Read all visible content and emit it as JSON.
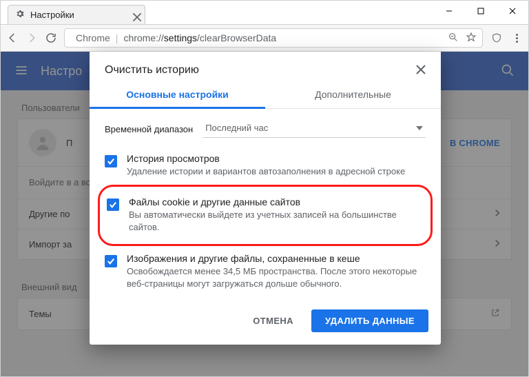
{
  "tab": {
    "title": "Настройки"
  },
  "omnibox": {
    "scheme_label": "Chrome",
    "url_grey1": "chrome://",
    "url_dark": "settings",
    "url_grey2": "/clearBrowserData"
  },
  "header": {
    "title": "Настро"
  },
  "sections": {
    "users_label": "Пользователи",
    "appearance_label": "Внешний вид"
  },
  "person": {
    "name": "П",
    "sign_in_btn": "В CHROME",
    "sign_in_desc": "Войдите в                                                                                                                               а всех устройств",
    "other_row": "Другие по",
    "import_row": "Импорт за"
  },
  "themes_row": "Темы",
  "dialog": {
    "title": "Очистить историю",
    "tabs": {
      "basic": "Основные настройки",
      "advanced": "Дополнительные"
    },
    "range_label": "Временной диапазон",
    "range_value": "Последний час",
    "items": [
      {
        "title": "История просмотров",
        "desc": "Удаление истории и вариантов автозаполнения в адресной строке"
      },
      {
        "title": "Файлы cookie и другие данные сайтов",
        "desc": "Вы автоматически выйдете из учетных записей на большинстве сайтов."
      },
      {
        "title": "Изображения и другие файлы, сохраненные в кеше",
        "desc": "Освобождается менее 34,5 МБ пространства. После этого некоторые веб-страницы могут загружаться дольше обычного."
      }
    ],
    "cancel": "ОТМЕНА",
    "confirm": "УДАЛИТЬ ДАННЫЕ"
  }
}
